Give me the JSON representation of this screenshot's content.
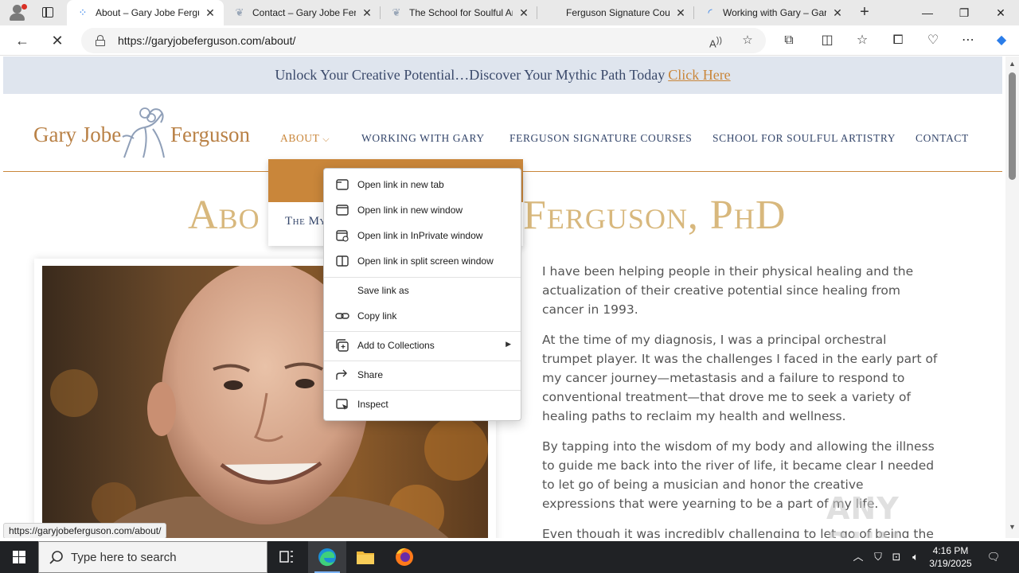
{
  "browser": {
    "tabs": [
      {
        "title": "About – Gary Jobe Fergu",
        "active": true
      },
      {
        "title": "Contact – Gary Jobe Ferg",
        "active": false
      },
      {
        "title": "The School for Soulful Ar",
        "active": false
      },
      {
        "title": "Ferguson Signature Cour",
        "active": false
      },
      {
        "title": "Working with Gary – Gar",
        "active": false
      }
    ],
    "url": "https://garyjobeferguson.com/about/",
    "status_url": "https://garyjobeferguson.com/about/"
  },
  "page": {
    "promo": {
      "text": "Unlock Your Creative Potential…Discover Your Mythic Path Today",
      "link": "Click Here"
    },
    "logo": {
      "word1": "Gary Jobe",
      "word2": "Ferguson"
    },
    "nav": {
      "about": "ABOUT",
      "working": "WORKING WITH GARY",
      "courses": "FERGUSON SIGNATURE COURSES",
      "school": "SCHOOL FOR SOULFUL ARTISTRY",
      "contact": "CONTACT"
    },
    "dropdown_item": "The My",
    "hero_left": "Abo",
    "hero_right": "Ferguson, PhD",
    "paragraphs": [
      "I have been helping people in their physical healing and the actualization of their creative potential since healing from cancer in 1993.",
      "At the time of my diagnosis, I was a principal orchestral trumpet player. It was the challenges I faced in the early part of my cancer journey—metastasis and a failure to respond to conventional treatment—that drove me to seek a variety of healing paths to reclaim my health and wellness.",
      "By tapping into the wisdom of my body and allowing the illness to guide me back into the river of life, it became clear I needed to let go of being a musician and honor the creative expressions that were yearning to be a part of my life.",
      "Even though it was incredibly challenging to let go of being the"
    ],
    "watermark": "ANY RUN"
  },
  "context_menu": {
    "items": [
      {
        "label": "Open link in new tab",
        "icon": "new-tab-icon"
      },
      {
        "label": "Open link in new window",
        "icon": "new-window-icon"
      },
      {
        "label": "Open link in InPrivate window",
        "icon": "inprivate-icon"
      },
      {
        "label": "Open link in split screen window",
        "icon": "split-screen-icon"
      },
      {
        "label": "Save link as",
        "icon": ""
      },
      {
        "label": "Copy link",
        "icon": "link-icon"
      },
      {
        "label": "Add to Collections",
        "icon": "collections-icon"
      },
      {
        "label": "Share",
        "icon": "share-icon"
      },
      {
        "label": "Inspect",
        "icon": "inspect-icon"
      }
    ]
  },
  "taskbar": {
    "search_placeholder": "Type here to search",
    "time": "4:16 PM",
    "date": "3/19/2025"
  },
  "colors": {
    "accent_gold": "#c9863a",
    "nav_blue": "#34466b",
    "title_gold": "#d8b87d",
    "promo_bg": "#dfe5ee"
  }
}
